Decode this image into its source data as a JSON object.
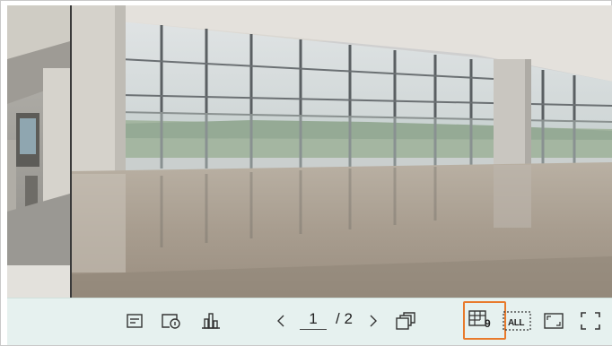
{
  "toolbar": {
    "pager": {
      "current": "1",
      "total": "/ 2"
    },
    "layout_split_label": "9",
    "all_label": "ALL"
  },
  "icons": [
    "event-list-icon",
    "playback-status-icon",
    "statistics-icon",
    "prev-page-icon",
    "next-page-icon",
    "sequence-icon",
    "split-9-icon",
    "all-channels-icon",
    "single-view-icon",
    "fullscreen-icon"
  ],
  "colors": {
    "toolbar_bg": "#e6f1ef",
    "highlight": "#e87a2c"
  }
}
